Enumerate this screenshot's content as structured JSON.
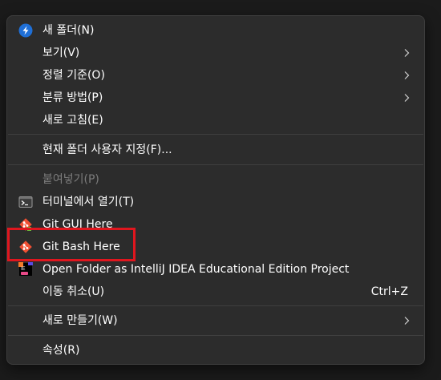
{
  "menu": {
    "items": [
      {
        "label": "새 폴더(N)",
        "icon": "new-folder-icon"
      },
      {
        "label": "보기(V)",
        "submenu": true
      },
      {
        "label": "정렬 기준(O)",
        "submenu": true
      },
      {
        "label": "분류 방법(P)",
        "submenu": true
      },
      {
        "label": "새로 고침(E)"
      },
      {
        "label": "현재 폴더 사용자 지정(F)..."
      },
      {
        "label": "붙여넣기(P)",
        "disabled": true
      },
      {
        "label": "터미널에서 열기(T)",
        "icon": "terminal-icon"
      },
      {
        "label": "Git GUI Here",
        "icon": "git-icon"
      },
      {
        "label": "Git Bash Here",
        "icon": "git-icon"
      },
      {
        "label": "Open Folder as IntelliJ IDEA Educational Edition Project",
        "icon": "intellij-edu-icon"
      },
      {
        "label": "이동 취소(U)",
        "shortcut": "Ctrl+Z"
      },
      {
        "label": "새로 만들기(W)",
        "submenu": true
      },
      {
        "label": "속성(R)"
      }
    ]
  },
  "colors": {
    "menu_bg": "#2c2c2c",
    "text": "#ffffff",
    "disabled_text": "#7d7d7d",
    "highlight_border": "#e0161e",
    "git_orange": "#f05033"
  },
  "annotation": {
    "highlighted_item": "Git Bash Here"
  }
}
